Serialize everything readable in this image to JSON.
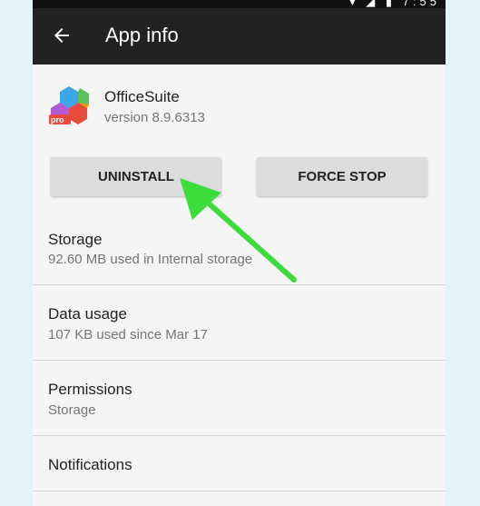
{
  "status_bar": {
    "icons": "▾ ◢ ▮ 7:55"
  },
  "app_bar": {
    "title": "App info"
  },
  "app": {
    "name": "OfficeSuite",
    "version": "version 8.9.6313",
    "icon_text": "pro"
  },
  "buttons": {
    "uninstall": "UNINSTALL",
    "force_stop": "FORCE STOP"
  },
  "rows": [
    {
      "title": "Storage",
      "subtitle": "92.60 MB used in Internal storage"
    },
    {
      "title": "Data usage",
      "subtitle": "107 KB used since Mar 17"
    },
    {
      "title": "Permissions",
      "subtitle": "Storage"
    },
    {
      "title": "Notifications",
      "subtitle": ""
    }
  ],
  "colors": {
    "appbar": "#222222",
    "annotation_arrow": "#3ddc3d",
    "outer_bg": "#e4f3f8"
  }
}
